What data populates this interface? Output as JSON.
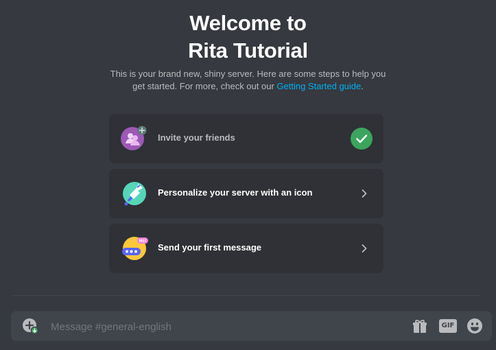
{
  "welcome": {
    "title_line1": "Welcome to",
    "title_line2": "Rita Tutorial",
    "subtitle_text": "This is your brand new, shiny server. Here are some steps to help you get started. For more, check out our ",
    "guide_link": "Getting Started guide",
    "subtitle_end": "."
  },
  "checklist": [
    {
      "label": "Invite your friends",
      "icon": "invite-friends-icon",
      "completed": true
    },
    {
      "label": "Personalize your server with an icon",
      "icon": "personalize-icon",
      "completed": false
    },
    {
      "label": "Send your first message",
      "icon": "send-message-icon",
      "completed": false
    }
  ],
  "icon_badge_text": "Hi!",
  "composer": {
    "placeholder": "Message #general-english",
    "gif_label": "GIF"
  },
  "colors": {
    "background": "#36393f",
    "card": "#2f3136",
    "composer": "#40444b",
    "link": "#00aff4",
    "success": "#3ba55d"
  }
}
